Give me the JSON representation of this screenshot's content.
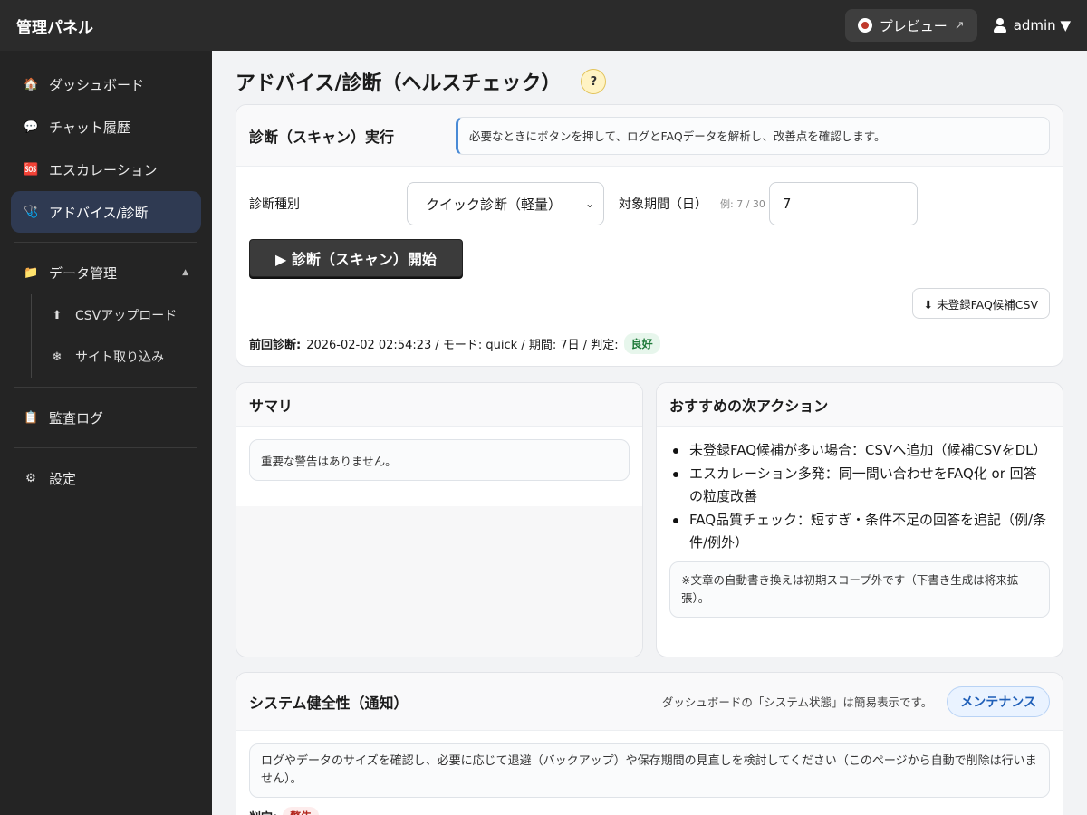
{
  "header": {
    "brand": "管理パネル",
    "preview_label": "プレビュー",
    "preview_ext": "↗",
    "user_label": "admin ▼"
  },
  "sidebar": {
    "items": [
      {
        "icon": "🏠",
        "label": "ダッシュボード"
      },
      {
        "icon": "💬",
        "label": "チャット履歴"
      },
      {
        "icon": "🆘",
        "label": "エスカレーション"
      },
      {
        "icon": "🩺",
        "label": "アドバイス/診断"
      }
    ],
    "data_group": {
      "icon": "📁",
      "label": "データ管理",
      "caret": "▲"
    },
    "sub_items": [
      {
        "icon": "⬆",
        "label": "CSVアップロード"
      },
      {
        "icon": "❄",
        "label": "サイト取り込み"
      }
    ],
    "audit": {
      "icon": "📋",
      "label": "監査ログ"
    },
    "settings": {
      "icon": "⚙",
      "label": "設定"
    }
  },
  "main": {
    "title": "アドバイス/診断（ヘルスチェック）",
    "help": "?",
    "scan": {
      "title": "診断（スキャン）実行",
      "note": "必要なときにボタンを押して、ログとFAQデータを解析し、改善点を確認します。",
      "type_label": "診断種別",
      "type_value": "クイック診断（軽量）",
      "period_label": "対象期間（日）",
      "period_hint": "例: 7 / 30",
      "period_value": "7",
      "start_button": "▶ 診断（スキャン）開始",
      "csv_button": "⬇ 未登録FAQ候補CSV",
      "last_run_label": "前回診断:",
      "last_run_text": "2026-02-02 02:54:23 / モード: quick / 期間: 7日 / 判定:",
      "last_run_badge": "良好"
    },
    "summary": {
      "title": "サマリ",
      "notice": "重要な警告はありません。"
    },
    "actions": {
      "title": "おすすめの次アクション",
      "items": [
        "未登録FAQ候補が多い場合：CSVへ追加（候補CSVをDL）",
        "エスカレーション多発：同一問い合わせをFAQ化 or 回答の粒度改善",
        "FAQ品質チェック：短すぎ・条件不足の回答を追記（例/条件/例外）"
      ],
      "note": "※文章の自動書き換えは初期スコープ外です（下書き生成は将来拡張）。"
    },
    "health": {
      "title": "システム健全性（通知）",
      "sub": "ダッシュボードの「システム状態」は簡易表示です。",
      "maint_button": "メンテナンス",
      "notice": "ログやデータのサイズを確認し、必要に応じて退避（バックアップ）や保存期間の見直しを検討してください（このページから自動で削除は行いません）。",
      "verdict_label": "判定:",
      "verdict_badge": "警告"
    }
  }
}
